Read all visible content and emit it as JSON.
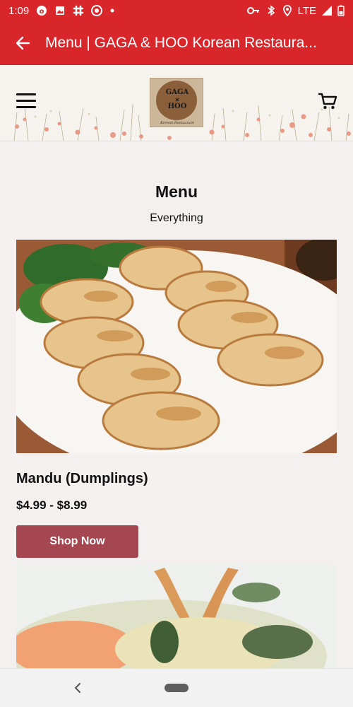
{
  "status_bar": {
    "time": "1:09",
    "network": "LTE",
    "icons": [
      "notification-icon",
      "image-icon",
      "slack-icon",
      "target-icon",
      "dot-icon",
      "vpn-key-icon",
      "bluetooth-icon",
      "location-icon",
      "signal-icon",
      "battery-icon"
    ]
  },
  "app_bar": {
    "title": "Menu | GAGA & HOO Korean Restaura...",
    "back_icon": "back-arrow-icon",
    "color": "#d8262b"
  },
  "header": {
    "logo": {
      "line1": "GAGA",
      "line2": "HOO",
      "tagline": "Korean Restaurant"
    },
    "menu_icon": "hamburger-icon",
    "cart_icon": "cart-icon"
  },
  "page": {
    "title": "Menu",
    "subtitle": "Everything"
  },
  "products": [
    {
      "name": "Mandu (Dumplings)",
      "price": "$4.99 - $8.99",
      "button": "Shop Now",
      "image": "dumplings-photo"
    },
    {
      "image": "tempura-photo"
    }
  ],
  "colors": {
    "accent": "#d8262b",
    "button": "#a54750",
    "background": "#f3f0ef"
  },
  "nav_bar": {
    "back_icon": "nav-back-icon",
    "home_icon": "nav-home-pill-icon"
  }
}
